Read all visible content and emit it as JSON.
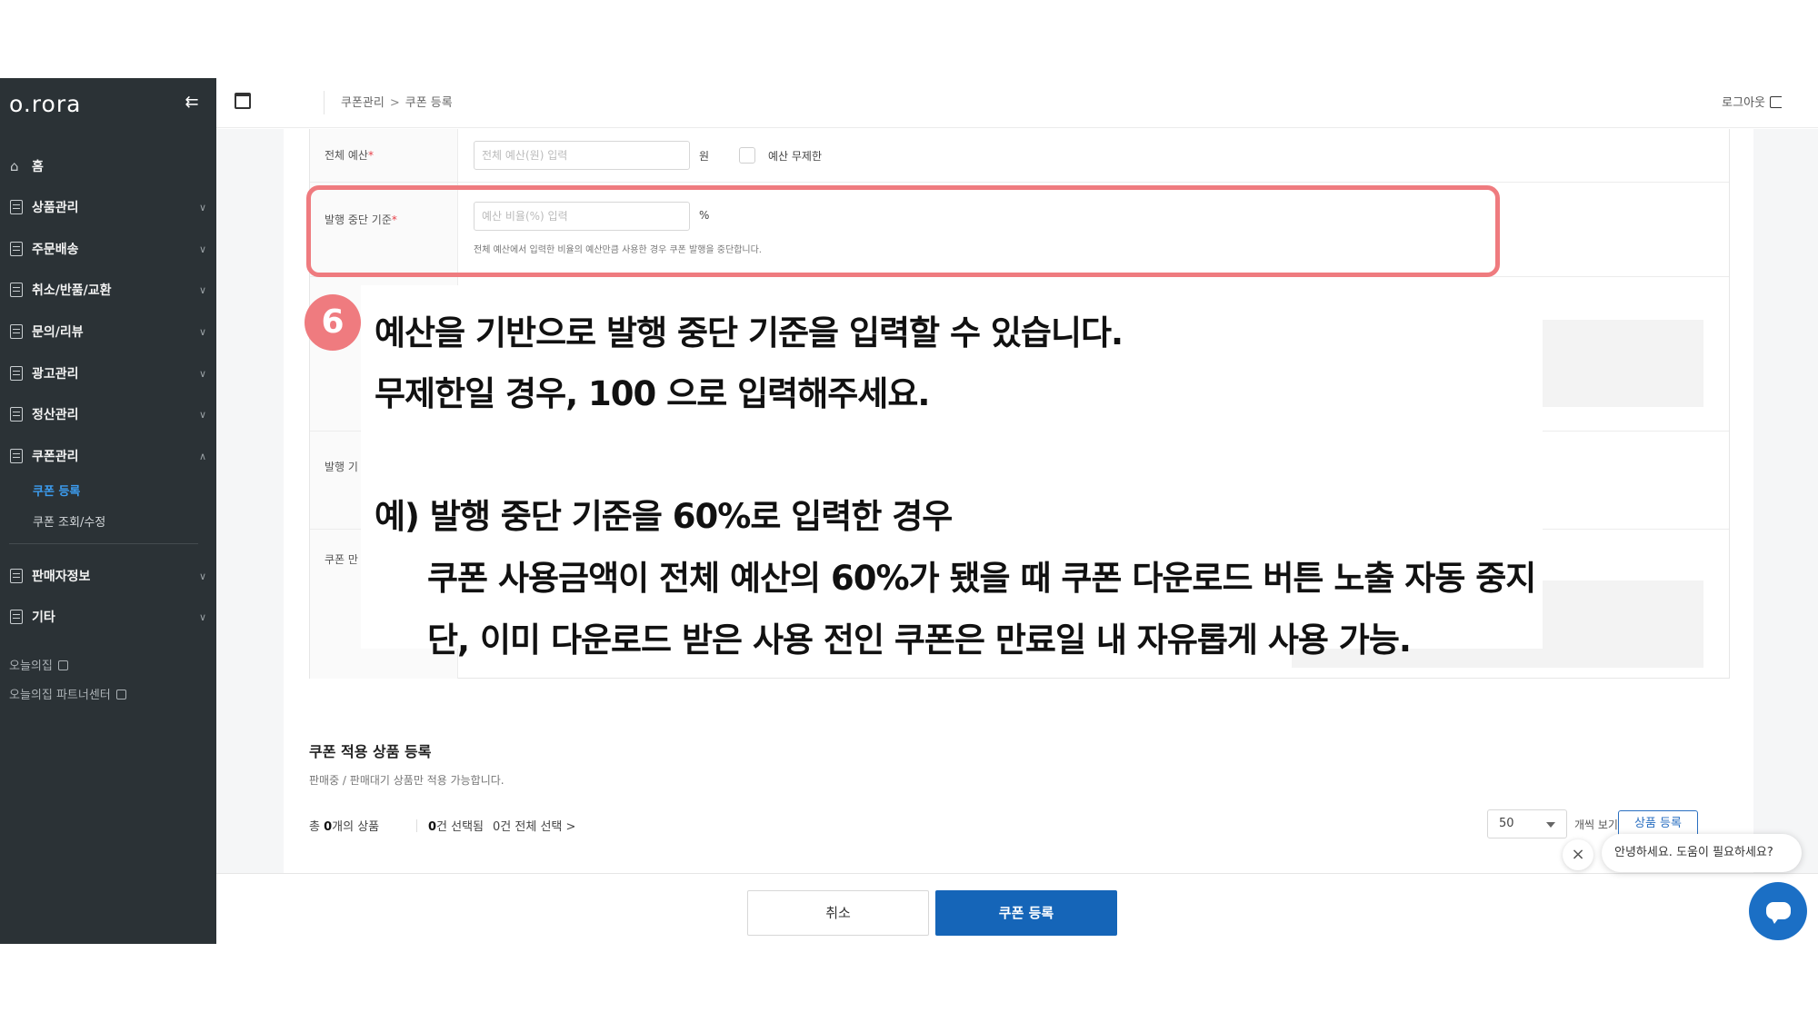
{
  "sidebar": {
    "logo": "o.rora",
    "collapse_icon": "collapse-left-icon",
    "items": [
      {
        "label": "홈"
      },
      {
        "label": "상품관리"
      },
      {
        "label": "주문배송"
      },
      {
        "label": "취소/반품/교환"
      },
      {
        "label": "문의/리뷰"
      },
      {
        "label": "광고관리"
      },
      {
        "label": "정산관리"
      },
      {
        "label": "쿠폰관리"
      },
      {
        "label": "판매자정보"
      },
      {
        "label": "기타"
      }
    ],
    "coupon_sub": [
      {
        "label": "쿠폰 등록",
        "active": true
      },
      {
        "label": "쿠폰 조회/수정",
        "active": false
      }
    ],
    "external_links": [
      {
        "label": "오늘의집"
      },
      {
        "label": "오늘의집 파트너센터"
      }
    ]
  },
  "header": {
    "breadcrumb": [
      "쿠폰관리",
      "쿠폰 등록"
    ],
    "breadcrumb_sep": ">",
    "logout": "로그아웃"
  },
  "form": {
    "total_budget": {
      "label": "전체 예산",
      "required_mark": "*",
      "placeholder": "전체 예산(원) 입력",
      "unit": "원",
      "unlimited_label": "예산 무제한"
    },
    "stop_criteria": {
      "label": "발행 중단 기준",
      "required_mark": "*",
      "placeholder": "예산 비율(%) 입력",
      "unit": "%",
      "hint": "전체 예산에서 입력한 비율의 예산만큼 사용한 경우 쿠폰 발행을 중단합니다."
    },
    "partial_labels": [
      "발행 기",
      "쿠폰 만"
    ]
  },
  "annotation": {
    "step": "6",
    "lines": [
      "예산을 기반으로 발행 중단 기준을 입력할 수 있습니다.",
      "무제한일 경우, 100 으로 입력해주세요.",
      "예) 발행 중단 기준을 60%로 입력한 경우",
      "쿠폰 사용금액이 전체 예산의 60%가 됐을 때 쿠폰 다운로드 버튼 노출 자동 중지",
      "단, 이미 다운로드 받은 사용 전인 쿠폰은 만료일 내 자유롭게 사용 가능."
    ],
    "highlight_color": "#ef7b7f"
  },
  "products": {
    "title": "쿠폰 적용 상품 등록",
    "description": "판매중 / 판매대기 상품만 적용 가능합니다.",
    "count_prefix": "총 ",
    "count_value": "0",
    "count_suffix": "개의 상품",
    "selected_value": "0",
    "selected_suffix": "건 선택됨",
    "select_all": "0건 전체 선택 >",
    "page_size": "50",
    "view_label": "개씩 보기",
    "add_button": "상품 등록"
  },
  "actions": {
    "cancel": "취소",
    "register": "쿠폰 등록"
  },
  "chat": {
    "greeting": "안녕하세요. 도움이 필요하세요?",
    "close_icon": "close-icon",
    "fab_icon": "chat-bubble-icon"
  },
  "colors": {
    "sidebar_bg": "#2b3236",
    "active_sub": "#3c9df0",
    "primary": "#1565b8",
    "required": "#e7414a"
  }
}
